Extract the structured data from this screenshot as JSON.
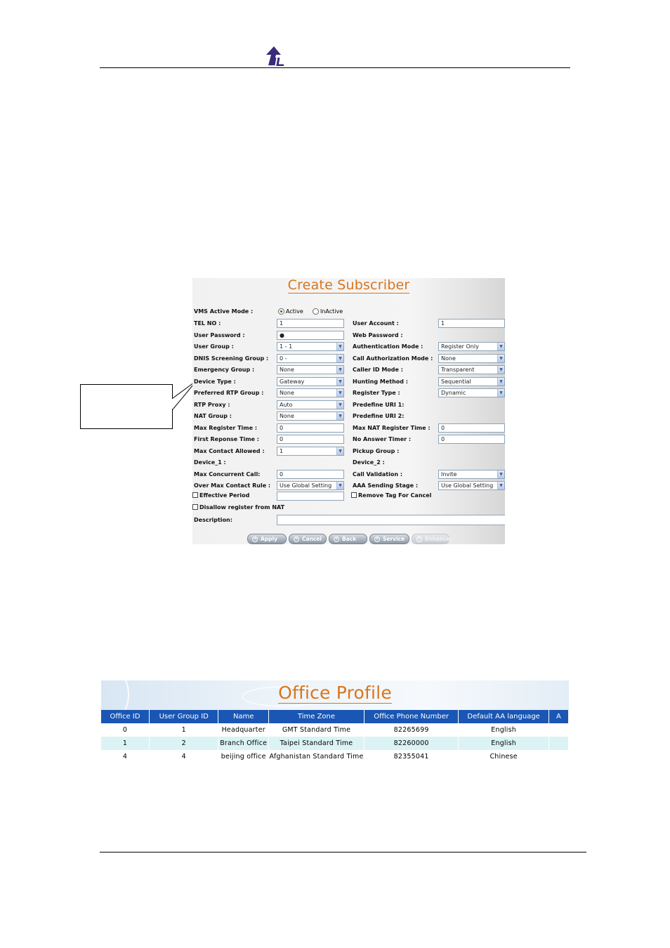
{
  "create_subscriber": {
    "title": "Create Subscriber",
    "vms_active_mode": {
      "label": "VMS Active Mode :",
      "options": [
        "Active",
        "InActive"
      ],
      "selected": "Active"
    },
    "left_fields": [
      {
        "label": "TEL NO :",
        "type": "text",
        "value": "1"
      },
      {
        "label": "User Password :",
        "type": "text",
        "value": "●"
      },
      {
        "label": "User Group :",
        "type": "select",
        "value": "1 - 1"
      },
      {
        "label": "DNIS Screening Group :",
        "type": "select",
        "value": "0 -"
      },
      {
        "label": "Emergency Group :",
        "type": "select",
        "value": "None"
      },
      {
        "label": "Device Type :",
        "type": "select",
        "value": "Gateway"
      },
      {
        "label": "Preferred RTP Group :",
        "type": "select",
        "value": "None"
      },
      {
        "label": "RTP Proxy :",
        "type": "select",
        "value": "Auto"
      },
      {
        "label": "NAT Group :",
        "type": "select",
        "value": "None"
      },
      {
        "label": "Max Register Time :",
        "type": "text",
        "value": "0"
      },
      {
        "label": "First Reponse Time :",
        "type": "text",
        "value": "0"
      },
      {
        "label": "Max Contact Allowed :",
        "type": "select",
        "value": "1"
      },
      {
        "label": "Device_1 :",
        "type": "none",
        "value": ""
      },
      {
        "label": "Max Concurrent Call:",
        "type": "text",
        "value": "0"
      },
      {
        "label": "Over Max Contact Rule :",
        "type": "select",
        "value": "Use Global Setting"
      }
    ],
    "right_fields": [
      {
        "label": "User Account :",
        "type": "text",
        "value": "1"
      },
      {
        "label": "Web Password :",
        "type": "none",
        "value": ""
      },
      {
        "label": "Authentication Mode :",
        "type": "select",
        "value": "Register Only"
      },
      {
        "label": "Call Authorization Mode :",
        "type": "select",
        "value": "None"
      },
      {
        "label": "Caller ID Mode :",
        "type": "select",
        "value": "Transparent"
      },
      {
        "label": "Hunting Method :",
        "type": "select",
        "value": "Sequential"
      },
      {
        "label": "Register Type :",
        "type": "select",
        "value": "Dynamic"
      },
      {
        "label": "Predefine URI 1:",
        "type": "none",
        "value": ""
      },
      {
        "label": "Predefine URI 2:",
        "type": "none",
        "value": ""
      },
      {
        "label": "Max NAT Register Time :",
        "type": "text",
        "value": "0"
      },
      {
        "label": "No Answer Timer :",
        "type": "text",
        "value": "0"
      },
      {
        "label": "Pickup Group :",
        "type": "none",
        "value": ""
      },
      {
        "label": "Device_2 :",
        "type": "none",
        "value": ""
      },
      {
        "label": "Call Validation :",
        "type": "select",
        "value": "Invite"
      },
      {
        "label": "AAA Sending Stage :",
        "type": "select",
        "value": "Use Global Setting"
      }
    ],
    "effective_period": {
      "label": "Effective Period",
      "value": ""
    },
    "remove_tag": {
      "label": "Remove Tag For Cancel"
    },
    "disallow_nat": {
      "label": "Disallow register from NAT"
    },
    "description": {
      "label": "Description:",
      "value": ""
    },
    "buttons": [
      "Apply",
      "Cancel",
      "Back",
      "Service",
      "Enhance"
    ]
  },
  "office_profile": {
    "title": "Office Profile",
    "columns": [
      "Office ID",
      "User Group ID",
      "Name",
      "Time Zone",
      "Office Phone Number",
      "Default AA language",
      "A"
    ],
    "rows": [
      [
        "0",
        "1",
        "Headquarter",
        "GMT Standard Time",
        "82265699",
        "English",
        ""
      ],
      [
        "1",
        "2",
        "Branch Office",
        "Taipei Standard Time",
        "82260000",
        "English",
        ""
      ],
      [
        "4",
        "4",
        "beijing office",
        "Afghanistan Standard Time",
        "82355041",
        "Chinese",
        ""
      ]
    ]
  },
  "colors": {
    "title_orange": "#d9751b",
    "table_header_blue": "#1a56b3",
    "row_alt": "#dbf3f5"
  }
}
